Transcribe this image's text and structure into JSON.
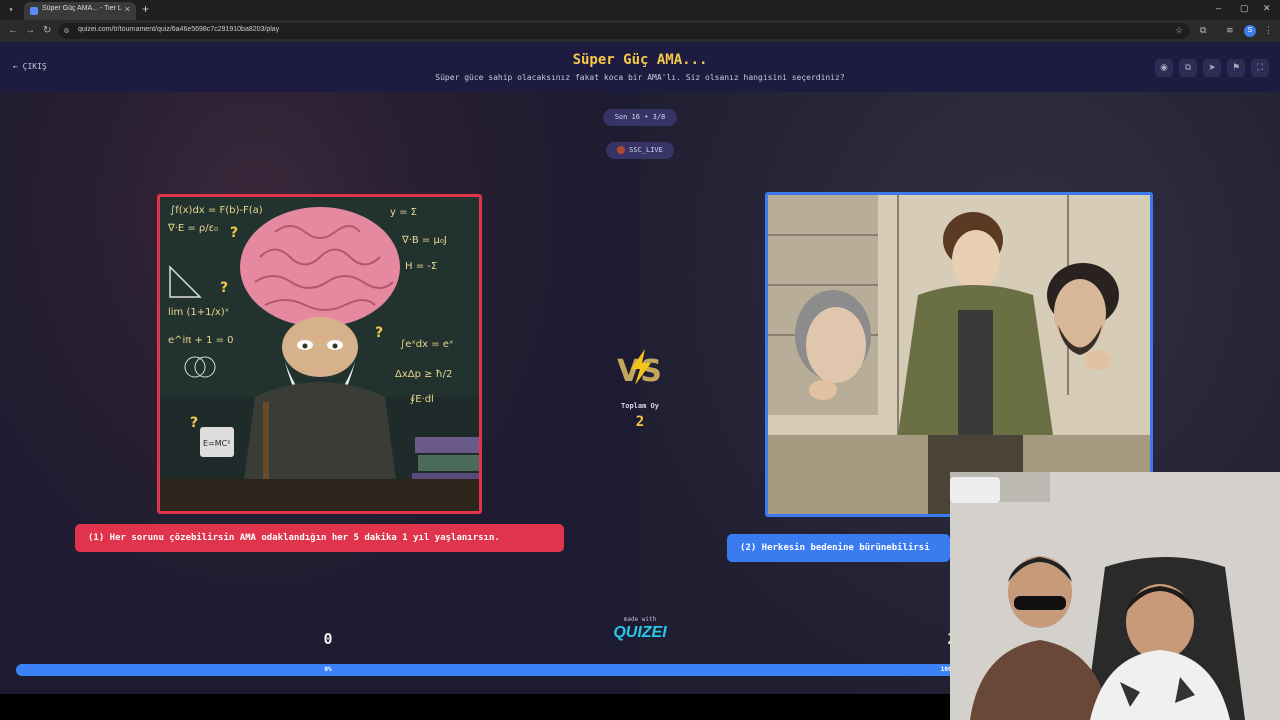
{
  "browser": {
    "tab_title": "Süper Güç AMA... - Tier List, Kı",
    "tab_close": "×",
    "new_tab": "+",
    "url": "quizei.com/tr/tournament/quiz/6a46e5698c7c291910ba8203/play",
    "profile_initial": "S",
    "window_controls": [
      "–",
      "▢",
      "✕"
    ]
  },
  "header": {
    "exit_label": "ÇIKIŞ",
    "title": "Süper Güç AMA...",
    "subtitle": "Süper güce sahip olacaksınız fakat koca bir AMA'lı. Siz olsanız hangisini seçerdiniz?",
    "icons": [
      "eye-icon",
      "copy-icon",
      "send-icon",
      "flag-icon",
      "fullscreen-icon"
    ]
  },
  "round": {
    "stage_label": "Son 16 • 3/8",
    "user_label": "SSC_LIVE"
  },
  "vs": {
    "total_label": "Toplam Oy",
    "total_value": "2"
  },
  "options": [
    {
      "label": "(1) Her sorunu çözebilirsin AMA odaklandığın her 5 dakika 1 yıl yaşlanırsın.",
      "votes": "0",
      "percent_label": "0%",
      "color": "#e0334c"
    },
    {
      "label": "(2) Herkesin bedenine bürünebilirsi",
      "votes": "2",
      "percent_label": "100%",
      "color": "#3a7bf0"
    }
  ],
  "progress": {
    "left_fraction": 0.0,
    "right_fraction": 1.0
  },
  "branding": {
    "made_with": "made with",
    "logo": "QUIZEI"
  },
  "colors": {
    "accent_yellow": "#f6c84a",
    "header_bg": "#1d1b3f"
  }
}
